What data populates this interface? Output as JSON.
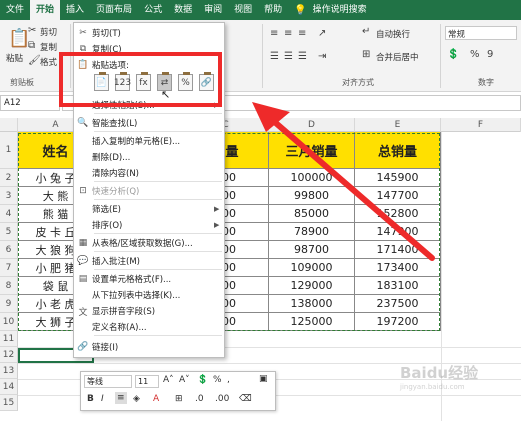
{
  "ribbon": {
    "tabs": [
      "文件",
      "开始",
      "插入",
      "页面布局",
      "公式",
      "数据",
      "审阅",
      "视图",
      "帮助",
      "操作说明搜索"
    ],
    "active_tab": "开始",
    "clipboard": {
      "cut": "剪切",
      "copy": "复制",
      "paste": "粘贴",
      "painter": "格式",
      "group_label": "剪贴板"
    },
    "alignment": {
      "wrap": "自动换行",
      "merge": "合并后居中",
      "group_label": "对齐方式"
    },
    "number": {
      "format": "常规",
      "group_label": "数字"
    }
  },
  "formula_bar": {
    "name_box": "A12"
  },
  "sheet": {
    "columns": [
      "A",
      "B",
      "C",
      "D",
      "E",
      "F"
    ],
    "rows": [
      "1",
      "2",
      "3",
      "4",
      "5",
      "6",
      "7",
      "8",
      "9",
      "10",
      "11",
      "12",
      "13",
      "14",
      "15"
    ],
    "headers": [
      "姓名",
      "",
      "销量",
      "三月销量",
      "总销量"
    ],
    "data": [
      [
        "小 兔 子",
        "",
        "400",
        "100000",
        "145900"
      ],
      [
        "大  熊",
        "",
        "100",
        "99800",
        "147700"
      ],
      [
        "熊  猫",
        "",
        "400",
        "85000",
        "152800"
      ],
      [
        "皮 卡 丘",
        "",
        "400",
        "78900",
        "147900"
      ],
      [
        "大 狼 狗",
        "",
        "400",
        "98700",
        "171400"
      ],
      [
        "小 肥 猪",
        "",
        "400",
        "109000",
        "173400"
      ],
      [
        "袋  鼠",
        "",
        "400",
        "129000",
        "183100"
      ],
      [
        "小 老 虎",
        "",
        "400",
        "138000",
        "237500"
      ],
      [
        "大 狮 子",
        "",
        "400",
        "125000",
        "197200"
      ]
    ]
  },
  "context_menu": {
    "items": [
      {
        "label": "剪切(T)",
        "icon": "scissors-icon"
      },
      {
        "label": "复制(C)",
        "icon": "copy-icon"
      },
      {
        "label": "粘贴选项:",
        "icon": "paste-icon"
      },
      {
        "label": "选择性粘贴(S)...",
        "icon": ""
      },
      {
        "label": "智能查找(L)",
        "icon": "search-icon"
      },
      {
        "label": "插入复制的单元格(E)...",
        "icon": ""
      },
      {
        "label": "删除(D)...",
        "icon": ""
      },
      {
        "label": "清除内容(N)",
        "icon": ""
      },
      {
        "label": "快速分析(Q)",
        "icon": "quick-analysis-icon"
      },
      {
        "label": "筛选(E)",
        "icon": ""
      },
      {
        "label": "排序(O)",
        "icon": ""
      },
      {
        "label": "从表格/区域获取数据(G)...",
        "icon": "table-icon"
      },
      {
        "label": "插入批注(M)",
        "icon": "comment-icon"
      },
      {
        "label": "设置单元格格式(F)...",
        "icon": "format-cells-icon"
      },
      {
        "label": "从下拉列表中选择(K)...",
        "icon": ""
      },
      {
        "label": "显示拼音字段(S)",
        "icon": "pinyin-icon"
      },
      {
        "label": "定义名称(A)...",
        "icon": ""
      },
      {
        "label": "链接(I)",
        "icon": "link-icon"
      }
    ]
  },
  "mini_toolbar": {
    "font": "等线",
    "size": "11",
    "bold": "B",
    "italic": "I",
    "percent": "%",
    "comma": ","
  },
  "watermark": {
    "text": "Baidu经验",
    "sub": "jingyan.baidu.com"
  },
  "colors": {
    "excel_green": "#217346",
    "header_yellow": "#ffe000",
    "highlight_red": "#ee2a2a"
  }
}
